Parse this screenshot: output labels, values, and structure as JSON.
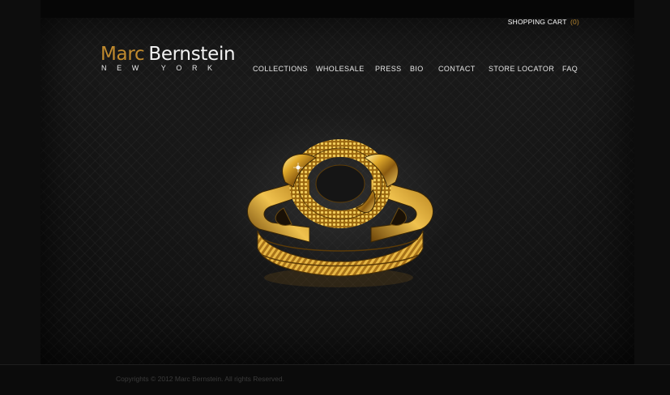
{
  "header": {
    "cart": {
      "label": "SHOPPING CART",
      "count": "(0)"
    }
  },
  "logo": {
    "first": "Marc",
    "last": "Bernstein",
    "city": "NEW YORK"
  },
  "nav": {
    "items": [
      {
        "label": "COLLECTIONS"
      },
      {
        "label": "WHOLESALE"
      },
      {
        "label": "PRESS"
      },
      {
        "label": "BIO"
      },
      {
        "label": "CONTACT"
      },
      {
        "label": "STORE LOCATOR"
      },
      {
        "label": "FAQ"
      }
    ]
  },
  "hero": {
    "subject": "gold-chain-link-bracelet"
  },
  "footer": {
    "copyright": "Copyrights © 2012 Marc Bernstein. All rights Reserved."
  },
  "colors": {
    "brand_gold": "#c08a2e",
    "cart_count": "#b8862f",
    "background": "#141414"
  }
}
